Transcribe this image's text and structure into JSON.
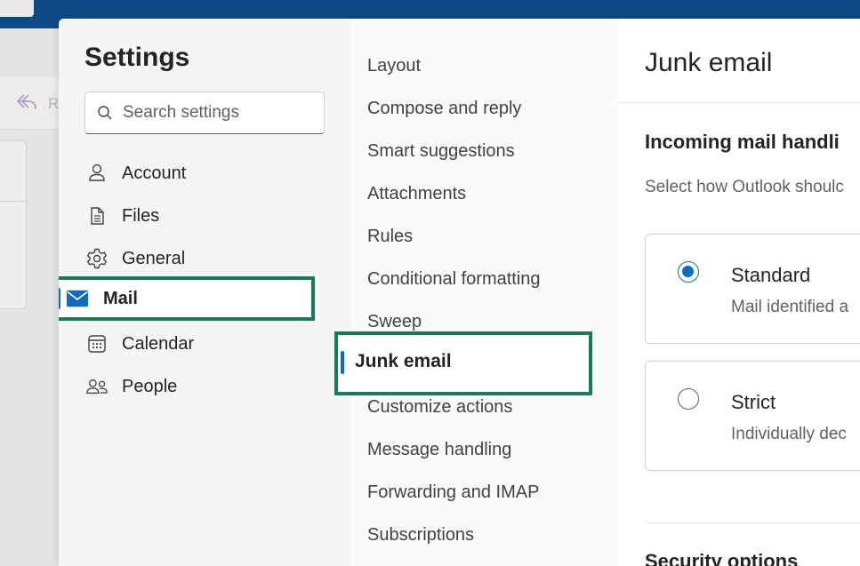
{
  "background": {
    "reply_label": "R"
  },
  "settings": {
    "title": "Settings",
    "search_placeholder": "Search settings",
    "nav": [
      {
        "label": "Account",
        "icon": "person-icon"
      },
      {
        "label": "Files",
        "icon": "document-icon"
      },
      {
        "label": "General",
        "icon": "gear-icon"
      },
      {
        "label": "Mail",
        "icon": "mail-icon",
        "selected": true
      },
      {
        "label": "Calendar",
        "icon": "calendar-icon"
      },
      {
        "label": "People",
        "icon": "people-icon"
      }
    ]
  },
  "mail_nav": {
    "items": [
      "Layout",
      "Compose and reply",
      "Smart suggestions",
      "Attachments",
      "Rules",
      "Conditional formatting",
      "Sweep",
      "Junk email",
      "Customize actions",
      "Message handling",
      "Forwarding and IMAP",
      "Subscriptions"
    ],
    "selected": "Junk email"
  },
  "content": {
    "title": "Junk email",
    "section_title": "Incoming mail handli",
    "section_desc": "Select how Outlook shoulc",
    "options": [
      {
        "title": "Standard",
        "desc": "Mail identified a",
        "checked": true
      },
      {
        "title": "Strict",
        "desc": "Individually dec",
        "checked": false
      }
    ],
    "section2_title": "Security options"
  },
  "colors": {
    "accent": "#0f6cbd",
    "highlight_border": "#177a5e",
    "title_bar": "#0f4a85"
  }
}
